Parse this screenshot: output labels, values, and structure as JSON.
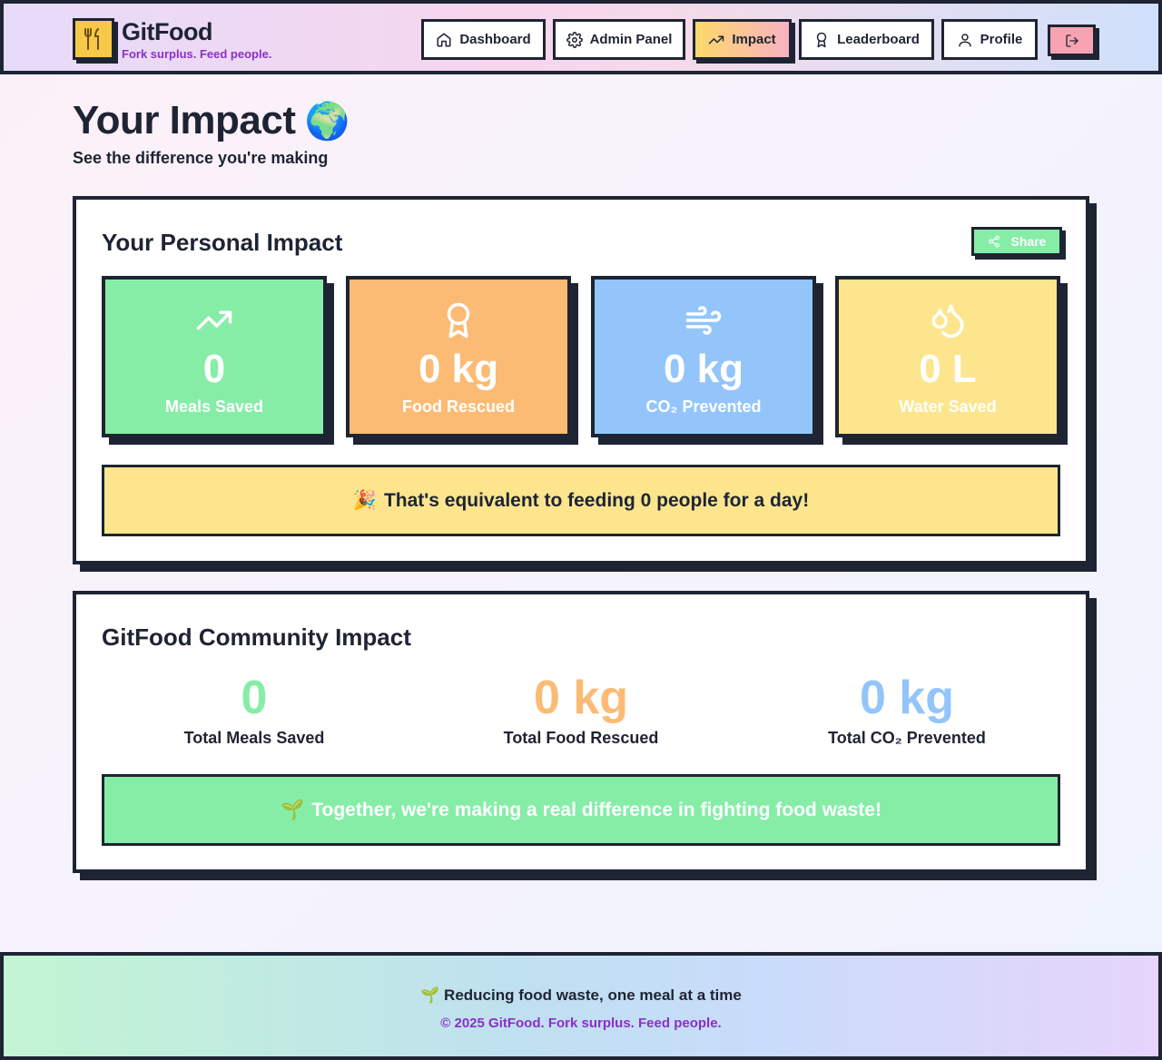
{
  "brand": {
    "name": "GitFood",
    "tagline": "Fork surplus. Feed people.",
    "logo_icon": "fork-knife-icon"
  },
  "nav": {
    "items": [
      {
        "label": "Dashboard",
        "icon": "home-icon",
        "active": false
      },
      {
        "label": "Admin Panel",
        "icon": "gear-icon",
        "active": false
      },
      {
        "label": "Impact",
        "icon": "trending-up-icon",
        "active": true
      },
      {
        "label": "Leaderboard",
        "icon": "award-icon",
        "active": false
      },
      {
        "label": "Profile",
        "icon": "user-icon",
        "active": false
      }
    ],
    "logout_icon": "logout-icon"
  },
  "page": {
    "title": "Your Impact",
    "title_emoji": "🌍",
    "subtitle": "See the difference you're making"
  },
  "personal": {
    "title": "Your Personal Impact",
    "share_label": "Share",
    "stats": [
      {
        "value": "0",
        "label": "Meals Saved",
        "icon": "trending-up-icon",
        "color": "#86eda7"
      },
      {
        "value": "0 kg",
        "label": "Food Rescued",
        "icon": "award-icon",
        "color": "#fcbb74"
      },
      {
        "value": "0 kg",
        "label": "CO₂ Prevented",
        "icon": "wind-icon",
        "color": "#93c5fb"
      },
      {
        "value": "0 L",
        "label": "Water Saved",
        "icon": "droplets-icon",
        "color": "#fce58d"
      }
    ],
    "banner_emoji": "🎉",
    "banner_text": "That's equivalent to feeding 0 people for a day!",
    "banner_color": "#fce58d"
  },
  "community": {
    "title": "GitFood Community Impact",
    "stats": [
      {
        "value": "0",
        "label": "Total Meals Saved",
        "color": "#86eda7"
      },
      {
        "value": "0 kg",
        "label": "Total Food Rescued",
        "color": "#fcbb74"
      },
      {
        "value": "0 kg",
        "label": "Total CO₂ Prevented",
        "color": "#93c5fb"
      }
    ],
    "banner_emoji": "🌱",
    "banner_text": "Together, we're making a real difference in fighting food waste!",
    "banner_color": "#86eda7"
  },
  "footer": {
    "line1_emoji": "🌱",
    "line1": "Reducing food waste, one meal at a time",
    "line2": "© 2025 GitFood. Fork surplus. Feed people."
  }
}
